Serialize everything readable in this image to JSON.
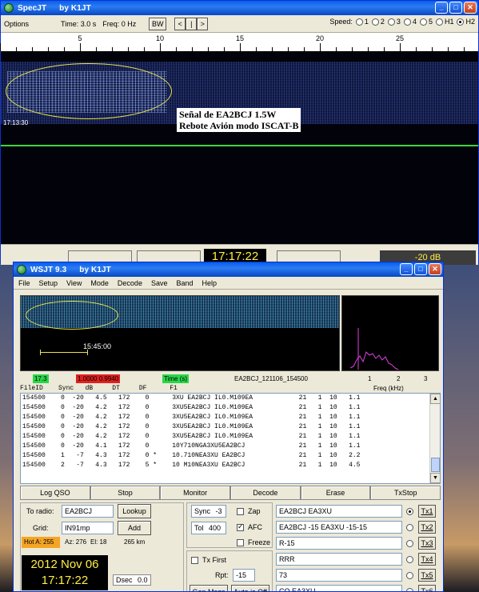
{
  "specjt": {
    "title": "SpecJT",
    "author": "by K1JT",
    "options_label": "Options",
    "time_text": "Time:  3.0 s",
    "freq_text": "Freq: 0 Hz",
    "bw_label": "BW",
    "nav_left": "<",
    "nav_mid": "|",
    "nav_right": ">",
    "speed_label": "Speed:",
    "speed_options": [
      "1",
      "2",
      "3",
      "4",
      "5",
      "H1",
      "H2"
    ],
    "ruler_labels": [
      "5",
      "10",
      "15",
      "20",
      "25"
    ],
    "timestamp": "17:13:30",
    "annotation_line1": "Señal de EA2BCJ 1.5W",
    "annotation_line2": "Rebote Avión modo ISCAT-B",
    "clock": "17:17:22",
    "db_text": "-20 dB"
  },
  "wsjt": {
    "title": "WSJT 9.3",
    "author": "by K1JT",
    "menu": [
      "File",
      "Setup",
      "View",
      "Mode",
      "Decode",
      "Save",
      "Band",
      "Help"
    ],
    "waterfall_time": "15:45:00",
    "info": {
      "snr": "17.3",
      "ratio": "1.0000  0.9940",
      "time_label": "Time (s)",
      "filename": "EA2BCJ_121106_154500",
      "freq_ticks": [
        "1",
        "2",
        "3"
      ],
      "freq_label": "Freq (kHz)"
    },
    "decode_headers": "FileID    Sync   dB     DT     DF      F1",
    "decode_lines": [
      "154500    0  -20   4.5   172    0      3XU EA2BCJ IL0.M109EA            21   1  10   1.1",
      "154500    0  -20   4.2   172    0      3XU5EA2BCJ IL0.M109EA            21   1  10   1.1",
      "154500    0  -20   4.2   172    0      3XU5EA2BCJ IL0.M109EA            21   1  10   1.1",
      "154500    0  -20   4.2   172    0      3XU5EA2BCJ IL0.M109EA            21   1  10   1.1",
      "154500    0  -20   4.2   172    0      3XU5EA2BCJ IL0.M109EA            21   1  10   1.1",
      "154500    0  -20   4.1   172    0      10Y710NGA3XU5EA2BCJ              21   1  10   1.1",
      "154500    1   -7   4.3   172    0 *    10.710NEA3XU EA2BCJ              21   1  10   2.2",
      "154500    2   -7   4.3   172    5 *    10 M10NEA3XU EA2BCJ              21   1  10   4.5"
    ],
    "actions": [
      "Log QSO",
      "Stop",
      "Monitor",
      "Decode",
      "Erase",
      "TxStop"
    ],
    "to_radio_label": "To radio:",
    "to_radio_value": "EA2BCJ",
    "lookup_label": "Lookup",
    "grid_label": "Grid:",
    "grid_value": "IN91mp",
    "add_label": "Add",
    "hot_a": "Hot A: 255",
    "az": "Az: 276",
    "el": "El: 18",
    "distance": "265 km",
    "date": "2012 Nov 06",
    "time": "17:17:22",
    "dsec_label": "Dsec",
    "dsec_value": "0.0",
    "sync_label": "Sync",
    "sync_value": "-3",
    "tol_label": "Tol",
    "tol_value": "400",
    "zap_label": "Zap",
    "afc_label": "AFC",
    "freeze_label": "Freeze",
    "txfirst_label": "Tx First",
    "rpt_label": "Rpt:",
    "rpt_value": "-15",
    "gen_msgs_label": "Gen Msgs",
    "auto_label": "Auto is Off",
    "tx_messages": [
      "EA2BCJ EA3XU",
      "EA2BCJ -15 EA3XU -15-15",
      "R-15",
      "RRR",
      "73",
      "CQ EA3XU"
    ],
    "tx_labels": [
      "Tx1",
      "Tx2",
      "Tx3",
      "Tx4",
      "Tx5",
      "Tx6"
    ]
  },
  "colors": {
    "title_blue": "#0a5ee8",
    "clock_yellow": "#ffee44",
    "hot_orange": "#f5a524",
    "green_box": "#2ad64a",
    "red_box": "#e02020"
  }
}
